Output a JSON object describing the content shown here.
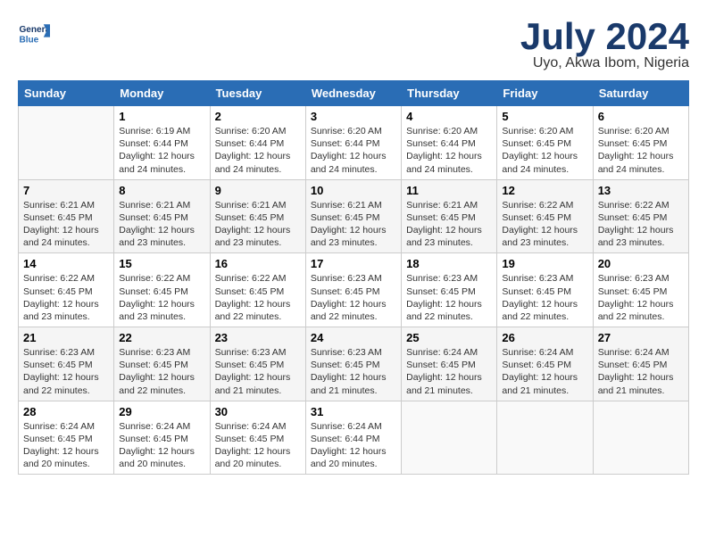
{
  "header": {
    "logo_line1": "General",
    "logo_line2": "Blue",
    "month": "July 2024",
    "location": "Uyo, Akwa Ibom, Nigeria"
  },
  "columns": [
    "Sunday",
    "Monday",
    "Tuesday",
    "Wednesday",
    "Thursday",
    "Friday",
    "Saturday"
  ],
  "weeks": [
    [
      {
        "day": "",
        "info": ""
      },
      {
        "day": "1",
        "info": "Sunrise: 6:19 AM\nSunset: 6:44 PM\nDaylight: 12 hours\nand 24 minutes."
      },
      {
        "day": "2",
        "info": "Sunrise: 6:20 AM\nSunset: 6:44 PM\nDaylight: 12 hours\nand 24 minutes."
      },
      {
        "day": "3",
        "info": "Sunrise: 6:20 AM\nSunset: 6:44 PM\nDaylight: 12 hours\nand 24 minutes."
      },
      {
        "day": "4",
        "info": "Sunrise: 6:20 AM\nSunset: 6:44 PM\nDaylight: 12 hours\nand 24 minutes."
      },
      {
        "day": "5",
        "info": "Sunrise: 6:20 AM\nSunset: 6:45 PM\nDaylight: 12 hours\nand 24 minutes."
      },
      {
        "day": "6",
        "info": "Sunrise: 6:20 AM\nSunset: 6:45 PM\nDaylight: 12 hours\nand 24 minutes."
      }
    ],
    [
      {
        "day": "7",
        "info": "Sunrise: 6:21 AM\nSunset: 6:45 PM\nDaylight: 12 hours\nand 24 minutes."
      },
      {
        "day": "8",
        "info": "Sunrise: 6:21 AM\nSunset: 6:45 PM\nDaylight: 12 hours\nand 23 minutes."
      },
      {
        "day": "9",
        "info": "Sunrise: 6:21 AM\nSunset: 6:45 PM\nDaylight: 12 hours\nand 23 minutes."
      },
      {
        "day": "10",
        "info": "Sunrise: 6:21 AM\nSunset: 6:45 PM\nDaylight: 12 hours\nand 23 minutes."
      },
      {
        "day": "11",
        "info": "Sunrise: 6:21 AM\nSunset: 6:45 PM\nDaylight: 12 hours\nand 23 minutes."
      },
      {
        "day": "12",
        "info": "Sunrise: 6:22 AM\nSunset: 6:45 PM\nDaylight: 12 hours\nand 23 minutes."
      },
      {
        "day": "13",
        "info": "Sunrise: 6:22 AM\nSunset: 6:45 PM\nDaylight: 12 hours\nand 23 minutes."
      }
    ],
    [
      {
        "day": "14",
        "info": "Sunrise: 6:22 AM\nSunset: 6:45 PM\nDaylight: 12 hours\nand 23 minutes."
      },
      {
        "day": "15",
        "info": "Sunrise: 6:22 AM\nSunset: 6:45 PM\nDaylight: 12 hours\nand 23 minutes."
      },
      {
        "day": "16",
        "info": "Sunrise: 6:22 AM\nSunset: 6:45 PM\nDaylight: 12 hours\nand 22 minutes."
      },
      {
        "day": "17",
        "info": "Sunrise: 6:23 AM\nSunset: 6:45 PM\nDaylight: 12 hours\nand 22 minutes."
      },
      {
        "day": "18",
        "info": "Sunrise: 6:23 AM\nSunset: 6:45 PM\nDaylight: 12 hours\nand 22 minutes."
      },
      {
        "day": "19",
        "info": "Sunrise: 6:23 AM\nSunset: 6:45 PM\nDaylight: 12 hours\nand 22 minutes."
      },
      {
        "day": "20",
        "info": "Sunrise: 6:23 AM\nSunset: 6:45 PM\nDaylight: 12 hours\nand 22 minutes."
      }
    ],
    [
      {
        "day": "21",
        "info": "Sunrise: 6:23 AM\nSunset: 6:45 PM\nDaylight: 12 hours\nand 22 minutes."
      },
      {
        "day": "22",
        "info": "Sunrise: 6:23 AM\nSunset: 6:45 PM\nDaylight: 12 hours\nand 22 minutes."
      },
      {
        "day": "23",
        "info": "Sunrise: 6:23 AM\nSunset: 6:45 PM\nDaylight: 12 hours\nand 21 minutes."
      },
      {
        "day": "24",
        "info": "Sunrise: 6:23 AM\nSunset: 6:45 PM\nDaylight: 12 hours\nand 21 minutes."
      },
      {
        "day": "25",
        "info": "Sunrise: 6:24 AM\nSunset: 6:45 PM\nDaylight: 12 hours\nand 21 minutes."
      },
      {
        "day": "26",
        "info": "Sunrise: 6:24 AM\nSunset: 6:45 PM\nDaylight: 12 hours\nand 21 minutes."
      },
      {
        "day": "27",
        "info": "Sunrise: 6:24 AM\nSunset: 6:45 PM\nDaylight: 12 hours\nand 21 minutes."
      }
    ],
    [
      {
        "day": "28",
        "info": "Sunrise: 6:24 AM\nSunset: 6:45 PM\nDaylight: 12 hours\nand 20 minutes."
      },
      {
        "day": "29",
        "info": "Sunrise: 6:24 AM\nSunset: 6:45 PM\nDaylight: 12 hours\nand 20 minutes."
      },
      {
        "day": "30",
        "info": "Sunrise: 6:24 AM\nSunset: 6:45 PM\nDaylight: 12 hours\nand 20 minutes."
      },
      {
        "day": "31",
        "info": "Sunrise: 6:24 AM\nSunset: 6:44 PM\nDaylight: 12 hours\nand 20 minutes."
      },
      {
        "day": "",
        "info": ""
      },
      {
        "day": "",
        "info": ""
      },
      {
        "day": "",
        "info": ""
      }
    ]
  ]
}
